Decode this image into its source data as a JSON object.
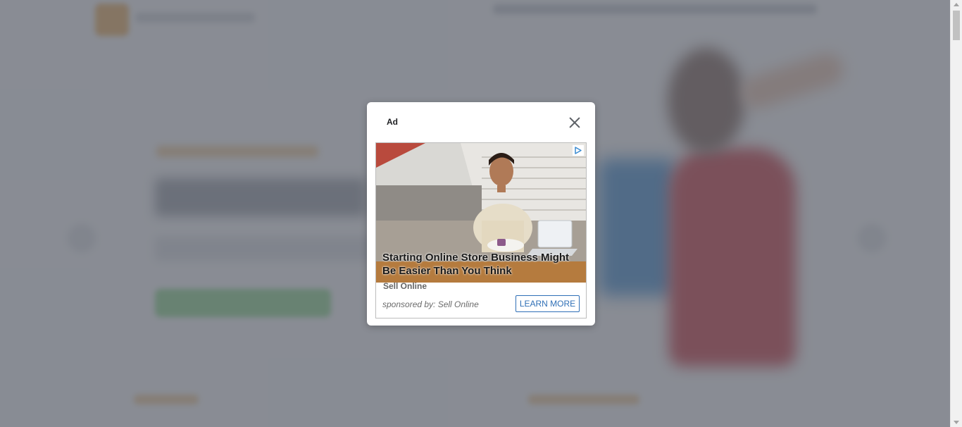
{
  "modal": {
    "title": "Ad",
    "close_icon": "close-icon"
  },
  "ad": {
    "headline": "Starting Online Store Business Might Be Easier Than You Think",
    "brand": "Sell Online",
    "sponsor": "sponsored by: Sell Online",
    "cta_label": "LEARN MORE",
    "adchoices_icon": "adchoices-icon",
    "image_subject": "man counting cash beside laptop"
  },
  "colors": {
    "overlay": "#5f646e",
    "cta_border": "#2f6fb6",
    "background_dress": "#c11f2a",
    "background_button": "#7ed07f"
  }
}
